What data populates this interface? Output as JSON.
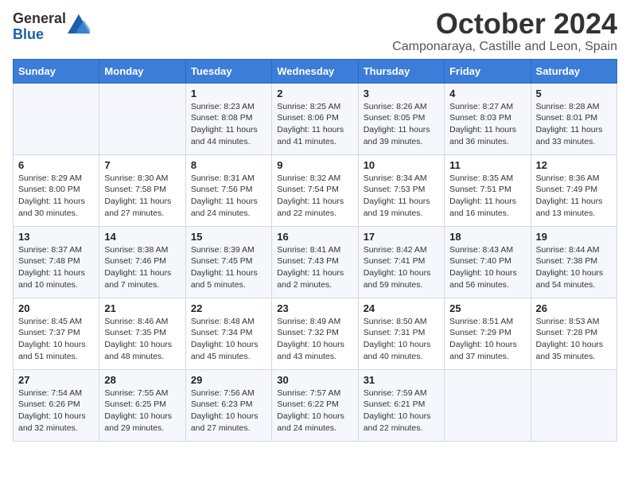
{
  "logo": {
    "general": "General",
    "blue": "Blue"
  },
  "title": "October 2024",
  "subtitle": "Camponaraya, Castille and Leon, Spain",
  "days_of_week": [
    "Sunday",
    "Monday",
    "Tuesday",
    "Wednesday",
    "Thursday",
    "Friday",
    "Saturday"
  ],
  "weeks": [
    [
      {
        "day": "",
        "sunrise": "",
        "sunset": "",
        "daylight": ""
      },
      {
        "day": "",
        "sunrise": "",
        "sunset": "",
        "daylight": ""
      },
      {
        "day": "1",
        "sunrise": "Sunrise: 8:23 AM",
        "sunset": "Sunset: 8:08 PM",
        "daylight": "Daylight: 11 hours and 44 minutes."
      },
      {
        "day": "2",
        "sunrise": "Sunrise: 8:25 AM",
        "sunset": "Sunset: 8:06 PM",
        "daylight": "Daylight: 11 hours and 41 minutes."
      },
      {
        "day": "3",
        "sunrise": "Sunrise: 8:26 AM",
        "sunset": "Sunset: 8:05 PM",
        "daylight": "Daylight: 11 hours and 39 minutes."
      },
      {
        "day": "4",
        "sunrise": "Sunrise: 8:27 AM",
        "sunset": "Sunset: 8:03 PM",
        "daylight": "Daylight: 11 hours and 36 minutes."
      },
      {
        "day": "5",
        "sunrise": "Sunrise: 8:28 AM",
        "sunset": "Sunset: 8:01 PM",
        "daylight": "Daylight: 11 hours and 33 minutes."
      }
    ],
    [
      {
        "day": "6",
        "sunrise": "Sunrise: 8:29 AM",
        "sunset": "Sunset: 8:00 PM",
        "daylight": "Daylight: 11 hours and 30 minutes."
      },
      {
        "day": "7",
        "sunrise": "Sunrise: 8:30 AM",
        "sunset": "Sunset: 7:58 PM",
        "daylight": "Daylight: 11 hours and 27 minutes."
      },
      {
        "day": "8",
        "sunrise": "Sunrise: 8:31 AM",
        "sunset": "Sunset: 7:56 PM",
        "daylight": "Daylight: 11 hours and 24 minutes."
      },
      {
        "day": "9",
        "sunrise": "Sunrise: 8:32 AM",
        "sunset": "Sunset: 7:54 PM",
        "daylight": "Daylight: 11 hours and 22 minutes."
      },
      {
        "day": "10",
        "sunrise": "Sunrise: 8:34 AM",
        "sunset": "Sunset: 7:53 PM",
        "daylight": "Daylight: 11 hours and 19 minutes."
      },
      {
        "day": "11",
        "sunrise": "Sunrise: 8:35 AM",
        "sunset": "Sunset: 7:51 PM",
        "daylight": "Daylight: 11 hours and 16 minutes."
      },
      {
        "day": "12",
        "sunrise": "Sunrise: 8:36 AM",
        "sunset": "Sunset: 7:49 PM",
        "daylight": "Daylight: 11 hours and 13 minutes."
      }
    ],
    [
      {
        "day": "13",
        "sunrise": "Sunrise: 8:37 AM",
        "sunset": "Sunset: 7:48 PM",
        "daylight": "Daylight: 11 hours and 10 minutes."
      },
      {
        "day": "14",
        "sunrise": "Sunrise: 8:38 AM",
        "sunset": "Sunset: 7:46 PM",
        "daylight": "Daylight: 11 hours and 7 minutes."
      },
      {
        "day": "15",
        "sunrise": "Sunrise: 8:39 AM",
        "sunset": "Sunset: 7:45 PM",
        "daylight": "Daylight: 11 hours and 5 minutes."
      },
      {
        "day": "16",
        "sunrise": "Sunrise: 8:41 AM",
        "sunset": "Sunset: 7:43 PM",
        "daylight": "Daylight: 11 hours and 2 minutes."
      },
      {
        "day": "17",
        "sunrise": "Sunrise: 8:42 AM",
        "sunset": "Sunset: 7:41 PM",
        "daylight": "Daylight: 10 hours and 59 minutes."
      },
      {
        "day": "18",
        "sunrise": "Sunrise: 8:43 AM",
        "sunset": "Sunset: 7:40 PM",
        "daylight": "Daylight: 10 hours and 56 minutes."
      },
      {
        "day": "19",
        "sunrise": "Sunrise: 8:44 AM",
        "sunset": "Sunset: 7:38 PM",
        "daylight": "Daylight: 10 hours and 54 minutes."
      }
    ],
    [
      {
        "day": "20",
        "sunrise": "Sunrise: 8:45 AM",
        "sunset": "Sunset: 7:37 PM",
        "daylight": "Daylight: 10 hours and 51 minutes."
      },
      {
        "day": "21",
        "sunrise": "Sunrise: 8:46 AM",
        "sunset": "Sunset: 7:35 PM",
        "daylight": "Daylight: 10 hours and 48 minutes."
      },
      {
        "day": "22",
        "sunrise": "Sunrise: 8:48 AM",
        "sunset": "Sunset: 7:34 PM",
        "daylight": "Daylight: 10 hours and 45 minutes."
      },
      {
        "day": "23",
        "sunrise": "Sunrise: 8:49 AM",
        "sunset": "Sunset: 7:32 PM",
        "daylight": "Daylight: 10 hours and 43 minutes."
      },
      {
        "day": "24",
        "sunrise": "Sunrise: 8:50 AM",
        "sunset": "Sunset: 7:31 PM",
        "daylight": "Daylight: 10 hours and 40 minutes."
      },
      {
        "day": "25",
        "sunrise": "Sunrise: 8:51 AM",
        "sunset": "Sunset: 7:29 PM",
        "daylight": "Daylight: 10 hours and 37 minutes."
      },
      {
        "day": "26",
        "sunrise": "Sunrise: 8:53 AM",
        "sunset": "Sunset: 7:28 PM",
        "daylight": "Daylight: 10 hours and 35 minutes."
      }
    ],
    [
      {
        "day": "27",
        "sunrise": "Sunrise: 7:54 AM",
        "sunset": "Sunset: 6:26 PM",
        "daylight": "Daylight: 10 hours and 32 minutes."
      },
      {
        "day": "28",
        "sunrise": "Sunrise: 7:55 AM",
        "sunset": "Sunset: 6:25 PM",
        "daylight": "Daylight: 10 hours and 29 minutes."
      },
      {
        "day": "29",
        "sunrise": "Sunrise: 7:56 AM",
        "sunset": "Sunset: 6:23 PM",
        "daylight": "Daylight: 10 hours and 27 minutes."
      },
      {
        "day": "30",
        "sunrise": "Sunrise: 7:57 AM",
        "sunset": "Sunset: 6:22 PM",
        "daylight": "Daylight: 10 hours and 24 minutes."
      },
      {
        "day": "31",
        "sunrise": "Sunrise: 7:59 AM",
        "sunset": "Sunset: 6:21 PM",
        "daylight": "Daylight: 10 hours and 22 minutes."
      },
      {
        "day": "",
        "sunrise": "",
        "sunset": "",
        "daylight": ""
      },
      {
        "day": "",
        "sunrise": "",
        "sunset": "",
        "daylight": ""
      }
    ]
  ]
}
